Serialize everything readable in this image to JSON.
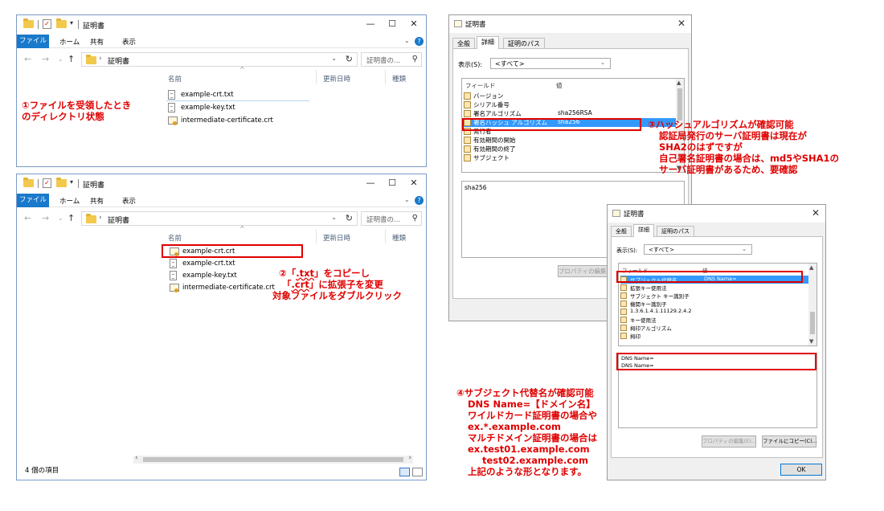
{
  "explorer": {
    "title": "証明書",
    "ribbon_tabs": [
      "ファイル",
      "ホーム",
      "共有",
      "表示"
    ],
    "address_path": "証明書",
    "search_placeholder": "証明書の...",
    "columns": [
      "名前",
      "更新日時",
      "種類"
    ],
    "files_before": [
      {
        "name": "example-crt.txt",
        "icon": "text-file-icon"
      },
      {
        "name": "example-key.txt",
        "icon": "text-file-icon"
      },
      {
        "name": "intermediate-certificate.crt",
        "icon": "certificate-file-icon"
      }
    ],
    "files_after": [
      {
        "name": "example-crt.crt",
        "icon": "certificate-file-icon"
      },
      {
        "name": "example-crt.txt",
        "icon": "text-file-icon"
      },
      {
        "name": "example-key.txt",
        "icon": "text-file-icon"
      },
      {
        "name": "intermediate-certificate.crt",
        "icon": "certificate-file-icon"
      }
    ],
    "status": "4 個の項目"
  },
  "dialog1": {
    "title": "証明書",
    "tabs": [
      "全般",
      "詳細",
      "証明のパス"
    ],
    "show_label": "表示(S):",
    "show_value": "<すべて>",
    "col_field": "フィールド",
    "col_value": "値",
    "fields": [
      {
        "name": "バージョン",
        "value": ""
      },
      {
        "name": "シリアル番号",
        "value": ""
      },
      {
        "name": "署名アルゴリズム",
        "value": "sha256RSA"
      },
      {
        "name": "署名ハッシュ アルゴリズム",
        "value": "sha256",
        "selected": true
      },
      {
        "name": "発行者",
        "value": ""
      },
      {
        "name": "有効期間の開始",
        "value": ""
      },
      {
        "name": "有効期間の終了",
        "value": ""
      },
      {
        "name": "サブジェクト",
        "value": ""
      }
    ],
    "detail_value": "sha256",
    "edit_button": "プロパティの編集(E)..."
  },
  "dialog2": {
    "title": "証明書",
    "tabs": [
      "全般",
      "詳細",
      "証明のパス"
    ],
    "show_label": "表示(S):",
    "show_value": "<すべて>",
    "col_field": "フィールド",
    "col_value": "値",
    "fields": [
      {
        "name": "サブジェクト代替名",
        "value": "DNS Name=",
        "selected": true
      },
      {
        "name": "拡張キー使用法",
        "value": ""
      },
      {
        "name": "サブジェクト キー識別子",
        "value": ""
      },
      {
        "name": "機関キー識別子",
        "value": ""
      },
      {
        "name": "1.3.6.1.4.1.11129.2.4.2",
        "value": ""
      },
      {
        "name": "キー使用法",
        "value": ""
      },
      {
        "name": "拇印アルゴリズム",
        "value": ""
      },
      {
        "name": "拇印",
        "value": ""
      }
    ],
    "detail_lines": [
      "DNS Name=",
      "DNS Name="
    ],
    "edit_button": "プロパティの編集(E)...",
    "copy_button": "ファイルにコピー(C)...",
    "ok_button": "OK"
  },
  "annotations": {
    "a1": [
      "①ファイルを受領したとき",
      "のディレクトリ状態"
    ],
    "a2": {
      "l1_prefix": "②「",
      "l1_ext": ".txt",
      "l1_suffix": "」をコピーし",
      "l2_prefix": "「",
      "l2_ext": ".crt",
      "l2_suffix": "」に拡張子を変更",
      "l3": "対象ファイルをダブルクリック"
    },
    "a3": [
      "③ハッシュアルゴリズムが確認可能",
      "認証局発行のサーバ証明書は現在が",
      "SHA2のはずですが",
      "自己署名証明書の場合は、md5やSHA1の",
      "サーバ証明書があるため、要確認"
    ],
    "a4": [
      "④サブジェクト代替名が確認可能",
      "DNS Name=【ドメイン名】",
      "ワイルドカード証明書の場合や",
      "ex.*.example.com",
      "マルチドメイン証明書の場合は",
      "ex.test01.example.com",
      "test02.example.com",
      "上記のような形となります。"
    ]
  },
  "colors": {
    "annotation": "#e00000",
    "file_tab": "#1979ca",
    "selection": "#3399ff"
  }
}
